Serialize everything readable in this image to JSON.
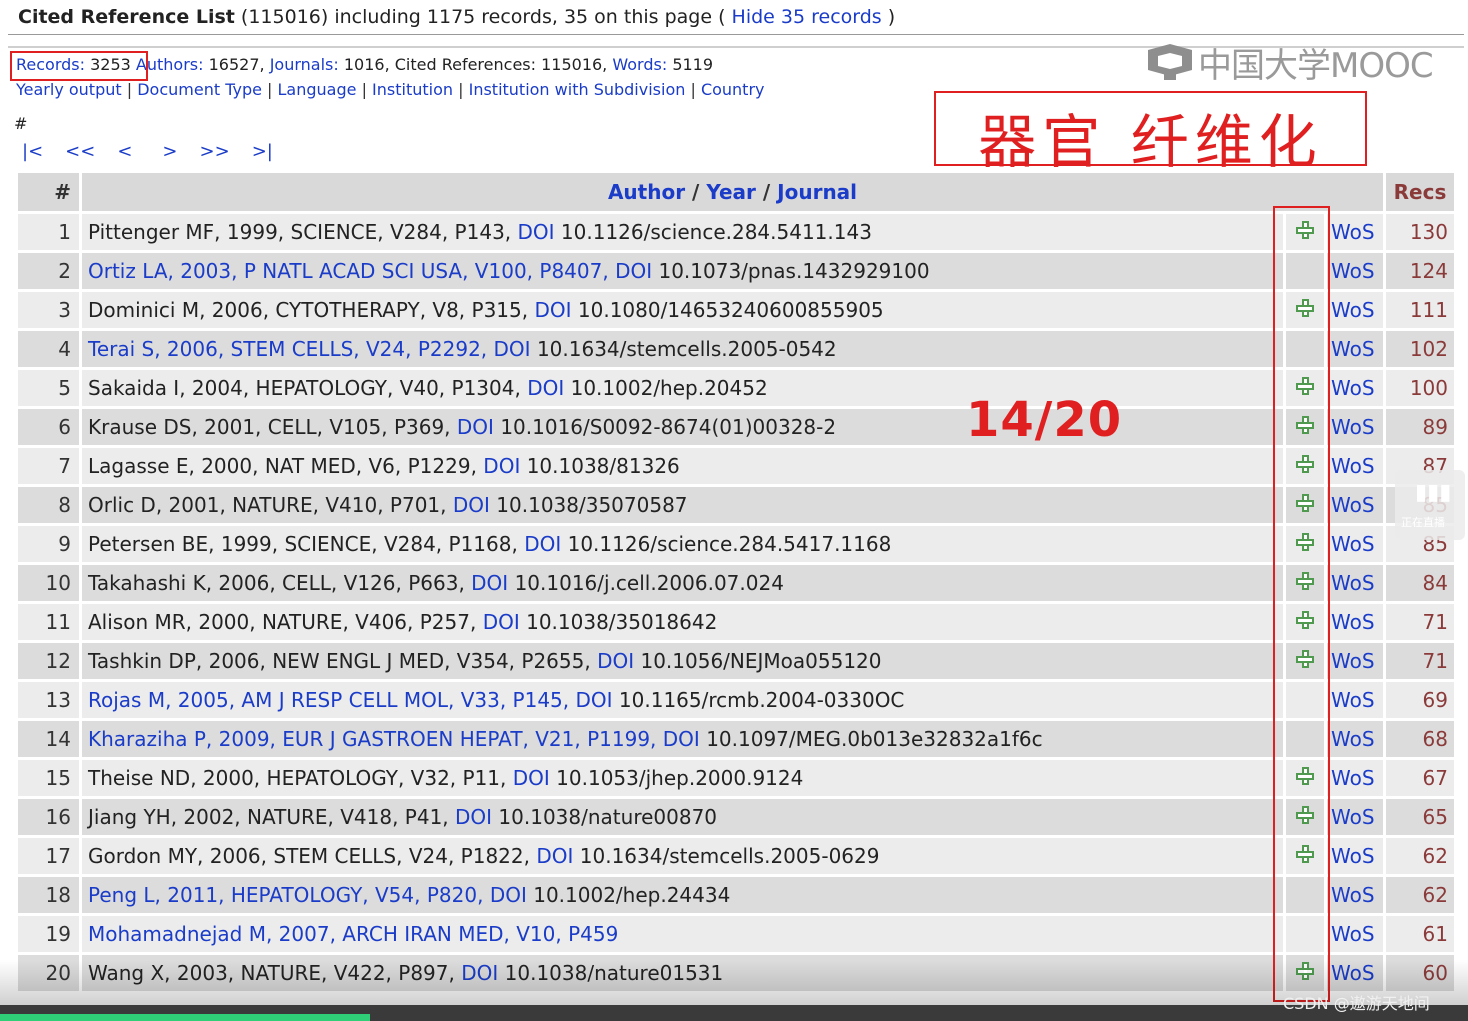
{
  "header": {
    "title": "Cited Reference List",
    "summary": "(115016) including 1175 records, 35 on this page (",
    "hide_link": "Hide 35 records",
    "summary_end": ")"
  },
  "stats": {
    "records_label": "Records:",
    "records_value": "3253",
    "authors_label": "Authors:",
    "authors_value": "16527,",
    "journals_label": "Journals:",
    "journals_value": "1016, Cited References: 115016,",
    "words_label": "Words:",
    "words_value": "5119"
  },
  "links": [
    "Yearly output",
    "Document Type",
    "Language",
    "Institution",
    "Institution with Subdivision",
    "Country"
  ],
  "hash_label": "#",
  "pager": [
    "|<",
    "<<",
    "<",
    ">",
    ">>",
    ">|"
  ],
  "watermark": "中国大学MOOC",
  "annotation_title": "器官 纤维化",
  "annotation_count": "14/20",
  "table": {
    "col_num": "#",
    "col_author": "Author",
    "col_year": "Year",
    "col_journal": "Journal",
    "col_sep": "/",
    "col_recs": "Recs",
    "wos_label": "WoS",
    "doi_label": "DOI",
    "rows": [
      {
        "n": "1",
        "ref": "Pittenger MF, 1999, SCIENCE, V284, P143,",
        "doi": "10.1126/science.284.5411.143",
        "blue": false,
        "plus": true,
        "recs": "130"
      },
      {
        "n": "2",
        "ref": "Ortiz LA, 2003, P NATL ACAD SCI USA, V100, P8407,",
        "doi": "10.1073/pnas.1432929100",
        "blue": true,
        "plus": false,
        "recs": "124"
      },
      {
        "n": "3",
        "ref": "Dominici M, 2006, CYTOTHERAPY, V8, P315,",
        "doi": "10.1080/14653240600855905",
        "blue": false,
        "plus": true,
        "recs": "111"
      },
      {
        "n": "4",
        "ref": "Terai S, 2006, STEM CELLS, V24, P2292,",
        "doi": "10.1634/stemcells.2005-0542",
        "blue": true,
        "plus": false,
        "recs": "102"
      },
      {
        "n": "5",
        "ref": "Sakaida I, 2004, HEPATOLOGY, V40, P1304,",
        "doi": "10.1002/hep.20452",
        "blue": false,
        "plus": true,
        "recs": "100"
      },
      {
        "n": "6",
        "ref": "Krause DS, 2001, CELL, V105, P369,",
        "doi": "10.1016/S0092-8674(01)00328-2",
        "blue": false,
        "plus": true,
        "recs": "89"
      },
      {
        "n": "7",
        "ref": "Lagasse E, 2000, NAT MED, V6, P1229,",
        "doi": "10.1038/81326",
        "blue": false,
        "plus": true,
        "recs": "87"
      },
      {
        "n": "8",
        "ref": "Orlic D, 2001, NATURE, V410, P701,",
        "doi": "10.1038/35070587",
        "blue": false,
        "plus": true,
        "recs": "85"
      },
      {
        "n": "9",
        "ref": "Petersen BE, 1999, SCIENCE, V284, P1168,",
        "doi": "10.1126/science.284.5417.1168",
        "blue": false,
        "plus": true,
        "recs": "85"
      },
      {
        "n": "10",
        "ref": "Takahashi K, 2006, CELL, V126, P663,",
        "doi": "10.1016/j.cell.2006.07.024",
        "blue": false,
        "plus": true,
        "recs": "84"
      },
      {
        "n": "11",
        "ref": "Alison MR, 2000, NATURE, V406, P257,",
        "doi": "10.1038/35018642",
        "blue": false,
        "plus": true,
        "recs": "71"
      },
      {
        "n": "12",
        "ref": "Tashkin DP, 2006, NEW ENGL J MED, V354, P2655,",
        "doi": "10.1056/NEJMoa055120",
        "blue": false,
        "plus": true,
        "recs": "71"
      },
      {
        "n": "13",
        "ref": "Rojas M, 2005, AM J RESP CELL MOL, V33, P145,",
        "doi": "10.1165/rcmb.2004-0330OC",
        "blue": true,
        "plus": false,
        "recs": "69"
      },
      {
        "n": "14",
        "ref": "Kharaziha P, 2009, EUR J GASTROEN HEPAT, V21, P1199,",
        "doi": "10.1097/MEG.0b013e32832a1f6c",
        "blue": true,
        "plus": false,
        "recs": "68"
      },
      {
        "n": "15",
        "ref": "Theise ND, 2000, HEPATOLOGY, V32, P11,",
        "doi": "10.1053/jhep.2000.9124",
        "blue": false,
        "plus": true,
        "recs": "67"
      },
      {
        "n": "16",
        "ref": "Jiang YH, 2002, NATURE, V418, P41,",
        "doi": "10.1038/nature00870",
        "blue": false,
        "plus": true,
        "recs": "65"
      },
      {
        "n": "17",
        "ref": "Gordon MY, 2006, STEM CELLS, V24, P1822,",
        "doi": "10.1634/stemcells.2005-0629",
        "blue": false,
        "plus": true,
        "recs": "62"
      },
      {
        "n": "18",
        "ref": "Peng L, 2011, HEPATOLOGY, V54, P820,",
        "doi": "10.1002/hep.24434",
        "blue": true,
        "plus": false,
        "recs": "62"
      },
      {
        "n": "19",
        "ref": "Mohamadnejad M, 2007, ARCH IRAN MED, V10, P459",
        "doi": "",
        "blue": true,
        "plus": false,
        "recs": "61"
      },
      {
        "n": "20",
        "ref": "Wang X, 2003, NATURE, V422, P897,",
        "doi": "10.1038/nature01531",
        "blue": false,
        "plus": true,
        "recs": "60"
      }
    ]
  },
  "side_widget_label": "正在直播",
  "footer_credit": "CSDN @遨游天地间",
  "video_progress": 0.252,
  "colors": {
    "link": "#1a3cc8",
    "annotation": "#e02020",
    "recs": "#8b3a3a",
    "plus": "#4f9a4f"
  }
}
